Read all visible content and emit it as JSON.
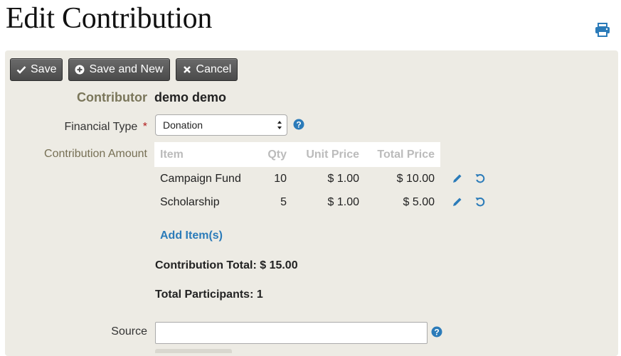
{
  "page": {
    "title": "Edit Contribution"
  },
  "toolbar": {
    "save_label": "Save",
    "save_new_label": "Save and New",
    "cancel_label": "Cancel"
  },
  "form": {
    "contributor_label": "Contributor",
    "contributor_value": "demo demo",
    "financial_type_label": "Financial Type",
    "required_mark": "*",
    "financial_type_value": "Donation",
    "contribution_amount_label": "Contribution Amount",
    "source_label": "Source",
    "source_value": ""
  },
  "items_table": {
    "headers": {
      "item": "Item",
      "qty": "Qty",
      "unit_price": "Unit Price",
      "total_price": "Total Price"
    },
    "rows": [
      {
        "item": "Campaign Fund",
        "qty": "10",
        "unit_price": "$ 1.00",
        "total_price": "$ 10.00"
      },
      {
        "item": "Scholarship",
        "qty": "5",
        "unit_price": "$ 1.00",
        "total_price": "$ 5.00"
      }
    ],
    "add_item_label": "Add Item(s)"
  },
  "totals": {
    "contribution_total": "Contribution Total: $ 15.00",
    "total_participants": "Total Participants: 1"
  },
  "colors": {
    "panel_bg": "#edebe4",
    "link_blue": "#2b7bb9",
    "label_olive": "#7a765a",
    "required_red": "#b11b1b"
  },
  "icons": [
    "print-icon",
    "check-icon",
    "plus-circle-icon",
    "times-icon",
    "help-icon",
    "pencil-icon",
    "undo-icon"
  ]
}
